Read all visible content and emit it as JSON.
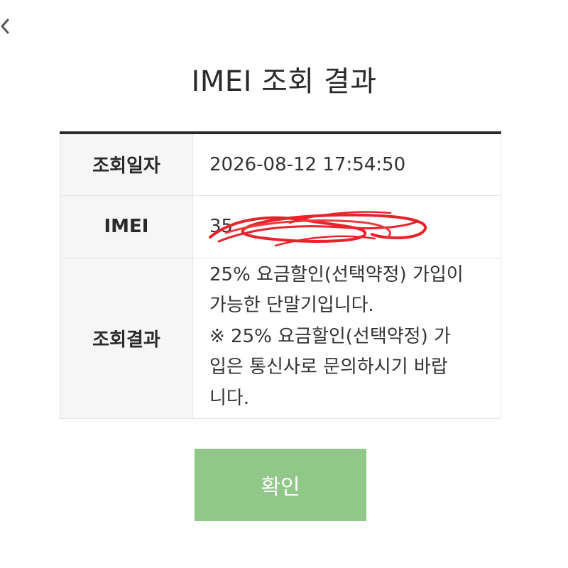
{
  "header": {
    "title": "IMEI 조회 결과",
    "back_icon": "chevron-left-icon"
  },
  "table": {
    "rows": [
      {
        "label": "조회일자",
        "value": "2026-08-12 17:54:50"
      },
      {
        "label": "IMEI",
        "value": "35"
      },
      {
        "label": "조회결과",
        "lines": [
          "25% 요금할인(선택약정) 가입이",
          "가능한 단말기입니다.",
          "※ 25% 요금할인(선택약정) 가",
          "입은 통신사로 문의하시기 바랍",
          "니다."
        ]
      }
    ]
  },
  "actions": {
    "confirm_label": "확인"
  },
  "colors": {
    "confirm_button": "#92c78a",
    "redaction_scribble": "#e8232b",
    "table_top_border": "#2b2b2b",
    "header_cell_bg": "#f6f6f6"
  }
}
